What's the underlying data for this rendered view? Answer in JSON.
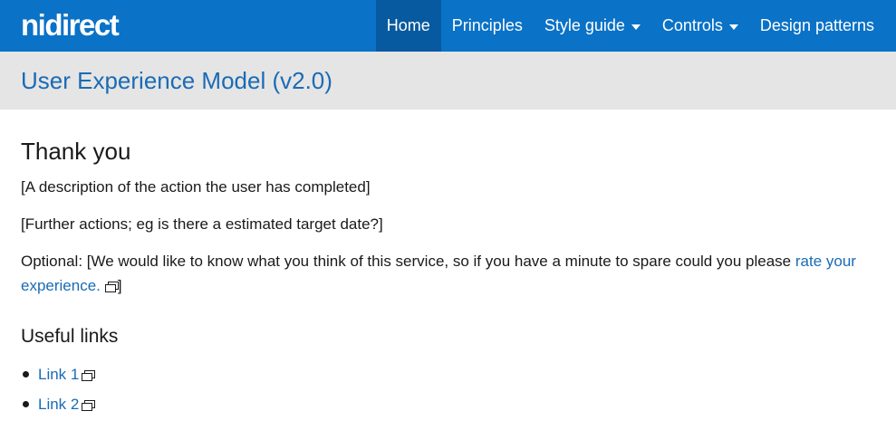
{
  "header": {
    "logo": "nidirect",
    "nav": [
      {
        "label": "Home",
        "active": true,
        "dropdown": false
      },
      {
        "label": "Principles",
        "active": false,
        "dropdown": false
      },
      {
        "label": "Style guide",
        "active": false,
        "dropdown": true
      },
      {
        "label": "Controls",
        "active": false,
        "dropdown": true
      },
      {
        "label": "Design patterns",
        "active": false,
        "dropdown": false
      }
    ]
  },
  "title_bar": {
    "title": "User Experience Model (v2.0)"
  },
  "content": {
    "heading": "Thank you",
    "paragraph1": "[A description of the action the user has completed]",
    "paragraph2": "[Further actions; eg is there a estimated target date?]",
    "paragraph3_before": "Optional: [We would like to know what you think of this service, so if you have a minute to spare could you please ",
    "paragraph3_link": "rate your experience.",
    "paragraph3_after": "]",
    "useful_links_heading": "Useful links",
    "useful_links": [
      "Link 1",
      "Link 2"
    ]
  },
  "icons": {
    "external": "external-link-icon",
    "dropdown": "caret-down-icon"
  },
  "colors": {
    "nav_bg": "#0a72c7",
    "nav_active_bg": "#075a9f",
    "title_bar_bg": "#e5e5e5",
    "link": "#1a6bb5"
  }
}
